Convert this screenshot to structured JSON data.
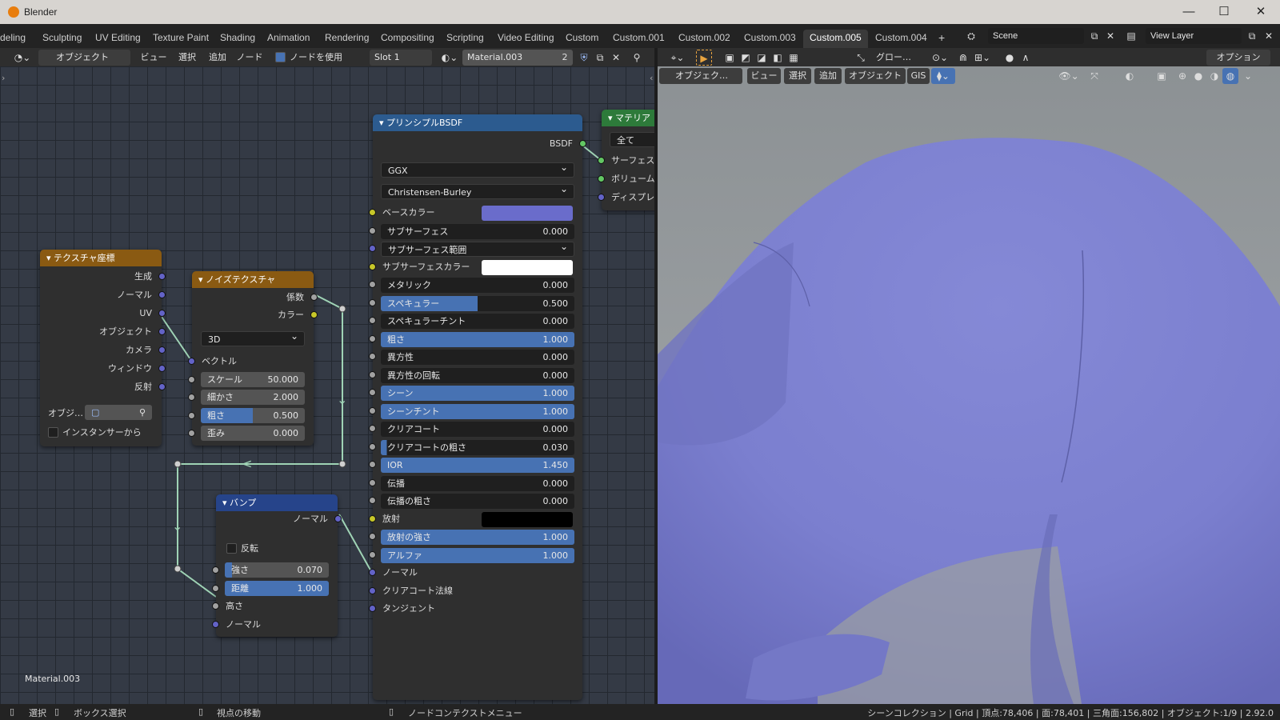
{
  "app": {
    "title": "Blender"
  },
  "workspace_tabs": [
    "deling",
    "Sculpting",
    "UV Editing",
    "Texture Paint",
    "Shading",
    "Animation",
    "Rendering",
    "Compositing",
    "Scripting",
    "Video Editing",
    "Custom",
    "Custom.001",
    "Custom.002",
    "Custom.003",
    "Custom.005",
    "Custom.004"
  ],
  "active_tab": "Custom.005",
  "scene_field": "Scene",
  "view_layer_field": "View Layer",
  "node_header": {
    "mode": "オブジェクト",
    "menu_view": "ビュー",
    "menu_select": "選択",
    "menu_add": "追加",
    "menu_node": "ノード",
    "use_nodes": "ノードを使用",
    "slot": "Slot 1",
    "material": "Material.003",
    "users": "2"
  },
  "viewport_header": {
    "transform": "グロー…",
    "options": "オプション",
    "mode": "オブジェク…",
    "menu_view": "ビュー",
    "menu_select": "選択",
    "menu_add": "追加",
    "menu_object": "オブジェクト",
    "menu_gis": "GIS"
  },
  "canvas_material_label": "Material.003",
  "nodes": {
    "texcoord": {
      "title": "テクスチャ座標",
      "outputs": [
        "生成",
        "ノーマル",
        "UV",
        "オブジェクト",
        "カメラ",
        "ウィンドウ",
        "反射"
      ],
      "object_label": "オブジ…",
      "from_instancer": "インスタンサーから"
    },
    "noise": {
      "title": "ノイズテクスチャ",
      "outputs": [
        "係数",
        "カラー"
      ],
      "dimensions": "3D",
      "vector": "ベクトル",
      "scale_label": "スケール",
      "scale": "50.000",
      "detail_label": "細かさ",
      "detail": "2.000",
      "roughness_label": "粗さ",
      "roughness": "0.500",
      "distortion_label": "歪み",
      "distortion": "0.000"
    },
    "bump": {
      "title": "バンプ",
      "output": "ノーマル",
      "invert": "反転",
      "strength_label": "強さ",
      "strength": "0.070",
      "distance_label": "距離",
      "distance": "1.000",
      "height": "高さ",
      "normal": "ノーマル"
    },
    "bsdf": {
      "title": "プリンシプルBSDF",
      "output": "BSDF",
      "distribution": "GGX",
      "subsurface_method": "Christensen-Burley",
      "rows": [
        {
          "label": "ベースカラー",
          "type": "color",
          "color": "#6a6ccb",
          "socket": "yellow"
        },
        {
          "label": "サブサーフェス",
          "value": "0.000",
          "socket": "gray"
        },
        {
          "label": "サブサーフェス範囲",
          "type": "select",
          "socket": "purple"
        },
        {
          "label": "サブサーフェスカラー",
          "type": "color",
          "color": "#ffffff",
          "socket": "yellow"
        },
        {
          "label": "メタリック",
          "value": "0.000",
          "socket": "gray"
        },
        {
          "label": "スペキュラー",
          "value": "0.500",
          "socket": "gray",
          "fill": 0.5
        },
        {
          "label": "スペキュラーチント",
          "value": "0.000",
          "socket": "gray"
        },
        {
          "label": "粗さ",
          "value": "1.000",
          "socket": "gray",
          "fill": 1
        },
        {
          "label": "異方性",
          "value": "0.000",
          "socket": "gray"
        },
        {
          "label": "異方性の回転",
          "value": "0.000",
          "socket": "gray"
        },
        {
          "label": "シーン",
          "value": "1.000",
          "socket": "gray",
          "fill": 1
        },
        {
          "label": "シーンチント",
          "value": "1.000",
          "socket": "gray",
          "fill": 1
        },
        {
          "label": "クリアコート",
          "value": "0.000",
          "socket": "gray"
        },
        {
          "label": "クリアコートの粗さ",
          "value": "0.030",
          "socket": "gray",
          "fill": 0.03
        },
        {
          "label": "IOR",
          "value": "1.450",
          "socket": "gray",
          "fill": 1,
          "light": true
        },
        {
          "label": "伝播",
          "value": "0.000",
          "socket": "gray"
        },
        {
          "label": "伝播の粗さ",
          "value": "0.000",
          "socket": "gray"
        },
        {
          "label": "放射",
          "type": "color",
          "color": "#000000",
          "socket": "yellow"
        },
        {
          "label": "放射の強さ",
          "value": "1.000",
          "socket": "gray",
          "fill": 1
        },
        {
          "label": "アルファ",
          "value": "1.000",
          "socket": "gray",
          "fill": 1
        },
        {
          "label": "ノーマル",
          "type": "socket",
          "socket": "purple"
        },
        {
          "label": "クリアコート法線",
          "type": "socket",
          "socket": "purple"
        },
        {
          "label": "タンジェント",
          "type": "socket",
          "socket": "purple"
        }
      ]
    },
    "output": {
      "title": "マテリア",
      "target": "全て",
      "inputs": [
        "サーフェス",
        "ボリューム",
        "ディスプレ"
      ]
    }
  },
  "statusbar": {
    "select": "選択",
    "box_select": "ボックス選択",
    "move_view": "視点の移動",
    "context_menu": "ノードコンテクストメニュー",
    "stats": "シーンコレクション | Grid | 頂点:78,406 | 面:78,401 | 三角面:156,802 | オブジェクト:1/9 | 2.92.0"
  },
  "colors": {
    "cloth": "#7b7fcf",
    "accent": "#4772b3",
    "header_input": "#8a5a12",
    "header_shader": "#26448a",
    "header_output": "#2d7a3a"
  }
}
